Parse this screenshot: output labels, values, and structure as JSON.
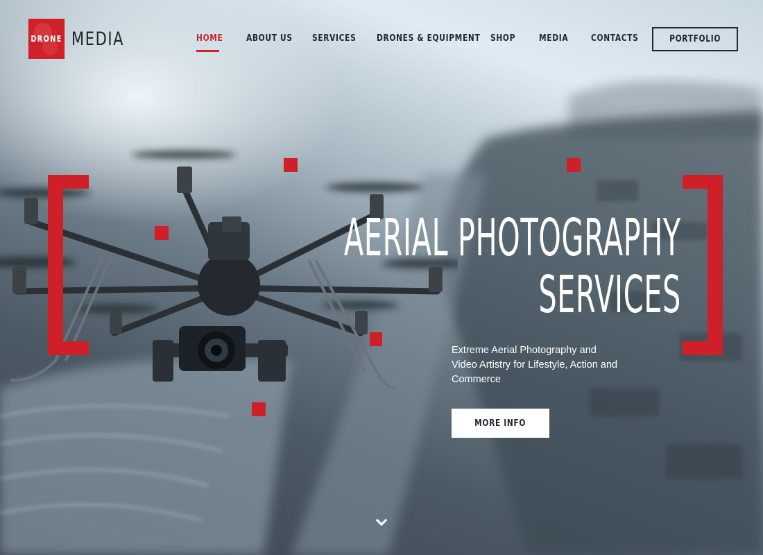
{
  "brand": {
    "logo_box_text": "DRONE",
    "logo_text": "MEDIA",
    "accent_color": "#cf1f28"
  },
  "nav": {
    "items": [
      {
        "label": "HOME",
        "active": true
      },
      {
        "label": "ABOUT US",
        "active": false
      },
      {
        "label": "SERVICES",
        "active": false
      },
      {
        "label": "DRONES & EQUIPMENT",
        "active": false
      },
      {
        "label": "SHOP",
        "active": false
      },
      {
        "label": "MEDIA",
        "active": false
      },
      {
        "label": "CONTACTS",
        "active": false
      }
    ],
    "cta_label": "PORTFOLIO"
  },
  "hero": {
    "headline_line1": "AERIAL PHOTOGRAPHY",
    "headline_line2": "SERVICES",
    "subtitle": "Extreme Aerial Photography and Video Artistry for Lifestyle, Action and Commerce",
    "button_label": "MORE INFO",
    "scroll_icon": "chevron-down-icon"
  }
}
